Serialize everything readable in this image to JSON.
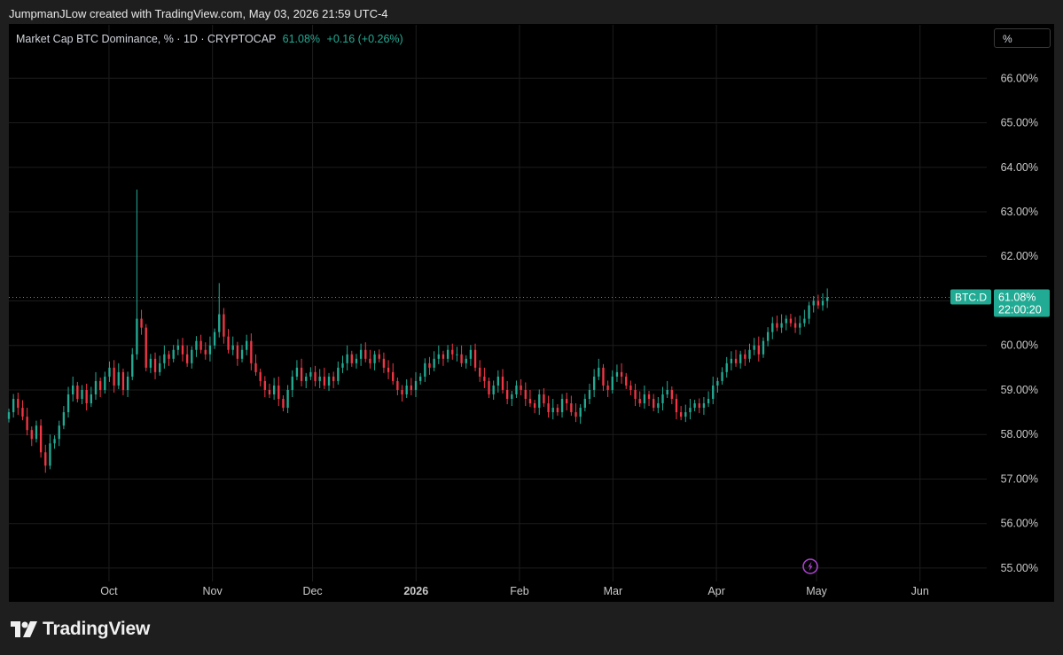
{
  "header": {
    "credit": "JumpmanJLow created with TradingView.com, May 03, 2026 21:59 UTC-4"
  },
  "legend": {
    "title": "Market Cap BTC Dominance, % · 1D · CRYPTOCAP",
    "value": "61.08%",
    "change": "+0.16 (+0.26%)"
  },
  "unit_selector": {
    "label": "%"
  },
  "price_tag": {
    "symbol": "BTC.D",
    "value": "61.08%",
    "countdown": "22:00:20"
  },
  "footer": {
    "brand": "TradingView"
  },
  "colors": {
    "up": "#22ab94",
    "down": "#f23645",
    "grid": "#1c1c1c",
    "text": "#c9c9c9",
    "background": "#000000"
  },
  "chart_data": {
    "type": "candlestick",
    "title": "Market Cap BTC Dominance, % · 1D · CRYPTOCAP",
    "ylabel": "%",
    "ylim": [
      54.7,
      67.2
    ],
    "yticks": [
      55,
      56,
      57,
      58,
      59,
      60,
      61,
      62,
      63,
      64,
      65,
      66
    ],
    "ytick_labels": [
      "55.00%",
      "56.00%",
      "57.00%",
      "58.00%",
      "59.00%",
      "60.00%",
      "61.00%",
      "62.00%",
      "63.00%",
      "64.00%",
      "65.00%",
      "66.00%"
    ],
    "x_start": "2025-09-01",
    "x_end": "2026-06-21",
    "xticks": [
      {
        "date": "2025-10-01",
        "label": "Oct",
        "bold": false
      },
      {
        "date": "2025-11-01",
        "label": "Nov",
        "bold": false
      },
      {
        "date": "2025-12-01",
        "label": "Dec",
        "bold": false
      },
      {
        "date": "2026-01-01",
        "label": "2026",
        "bold": true
      },
      {
        "date": "2026-02-01",
        "label": "Feb",
        "bold": false
      },
      {
        "date": "2026-03-01",
        "label": "Mar",
        "bold": false
      },
      {
        "date": "2026-04-01",
        "label": "Apr",
        "bold": false
      },
      {
        "date": "2026-05-01",
        "label": "May",
        "bold": false
      },
      {
        "date": "2026-06-01",
        "label": "Jun",
        "bold": false
      }
    ],
    "start_date": "2025-09-01",
    "last_value": 61.08,
    "closes": [
      58.5,
      58.8,
      58.6,
      58.4,
      58.1,
      57.9,
      58.2,
      57.6,
      57.3,
      57.8,
      57.9,
      58.2,
      58.5,
      58.9,
      59.1,
      58.8,
      59.0,
      58.7,
      58.9,
      59.2,
      59.0,
      59.3,
      59.5,
      59.1,
      59.4,
      59.0,
      59.3,
      59.8,
      60.6,
      60.4,
      59.5,
      59.7,
      59.4,
      59.6,
      59.8,
      59.7,
      59.9,
      60.0,
      59.8,
      59.6,
      59.9,
      60.1,
      59.9,
      59.8,
      60.0,
      60.3,
      60.7,
      60.2,
      59.9,
      60.0,
      59.7,
      59.9,
      60.1,
      59.6,
      59.4,
      59.2,
      59.0,
      58.9,
      59.1,
      58.8,
      58.6,
      59.0,
      59.3,
      59.5,
      59.2,
      59.3,
      59.4,
      59.2,
      59.3,
      59.1,
      59.3,
      59.2,
      59.5,
      59.6,
      59.8,
      59.6,
      59.7,
      59.9,
      59.7,
      59.6,
      59.8,
      59.7,
      59.5,
      59.4,
      59.2,
      59.0,
      58.9,
      59.1,
      59.0,
      59.2,
      59.3,
      59.6,
      59.5,
      59.7,
      59.8,
      59.7,
      59.9,
      59.8,
      59.8,
      59.6,
      59.7,
      59.9,
      59.5,
      59.3,
      59.2,
      58.9,
      59.1,
      59.3,
      59.0,
      58.8,
      58.9,
      59.1,
      59.0,
      58.8,
      58.7,
      58.6,
      58.9,
      58.7,
      58.5,
      58.6,
      58.5,
      58.8,
      58.7,
      58.5,
      58.4,
      58.6,
      58.8,
      59.0,
      59.3,
      59.5,
      59.1,
      59.0,
      59.3,
      59.4,
      59.3,
      59.1,
      59.0,
      58.8,
      58.7,
      58.9,
      58.8,
      58.6,
      58.7,
      58.9,
      59.0,
      58.8,
      58.5,
      58.4,
      58.5,
      58.6,
      58.7,
      58.6,
      58.7,
      58.8,
      59.1,
      59.2,
      59.4,
      59.6,
      59.7,
      59.6,
      59.8,
      59.7,
      59.9,
      60.0,
      59.8,
      60.1,
      60.3,
      60.5,
      60.4,
      60.5,
      60.6,
      60.5,
      60.4,
      60.5,
      60.6,
      60.9,
      61.0,
      60.9,
      61.0,
      61.08
    ]
  }
}
